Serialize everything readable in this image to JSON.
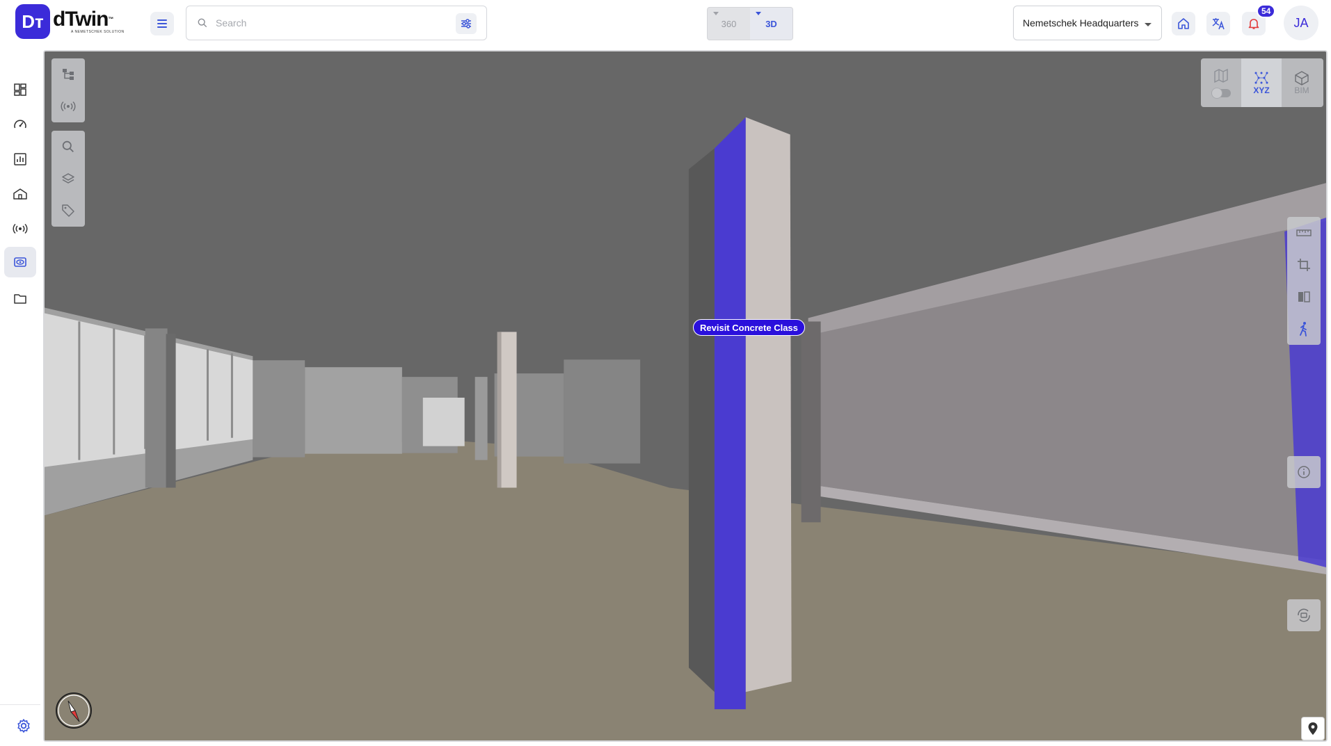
{
  "app": {
    "logo_mark": "Dт",
    "logo_text": "dTwin",
    "logo_tm": "™",
    "logo_sub": "A NEMETSCHEK SOLUTION"
  },
  "header": {
    "search_placeholder": "Search",
    "view_modes": [
      {
        "label": "360",
        "active": false
      },
      {
        "label": "3D",
        "active": true
      }
    ],
    "site": "Nemetschek Headquarters",
    "notifications_count": "54",
    "user_initials": "JA"
  },
  "sidebar": {
    "items": [
      {
        "name": "dashboard"
      },
      {
        "name": "performance"
      },
      {
        "name": "reports"
      },
      {
        "name": "buildings"
      },
      {
        "name": "sensors"
      },
      {
        "name": "viewer",
        "active": true
      },
      {
        "name": "files"
      }
    ]
  },
  "viewer": {
    "view_panel": [
      {
        "label": "",
        "icon": "map-3d-icon",
        "active": false
      },
      {
        "label": "XYZ",
        "icon": "xyz-points-icon",
        "active": true
      },
      {
        "label": "BIM",
        "icon": "bim-cube-icon",
        "active": false
      }
    ],
    "annotation_label": "Revisit Concrete Class"
  },
  "colors": {
    "brand": "#3b2bd9",
    "accent": "#3b55d9",
    "highlight": "#4a3bd0",
    "notification": "#e23a3a"
  }
}
